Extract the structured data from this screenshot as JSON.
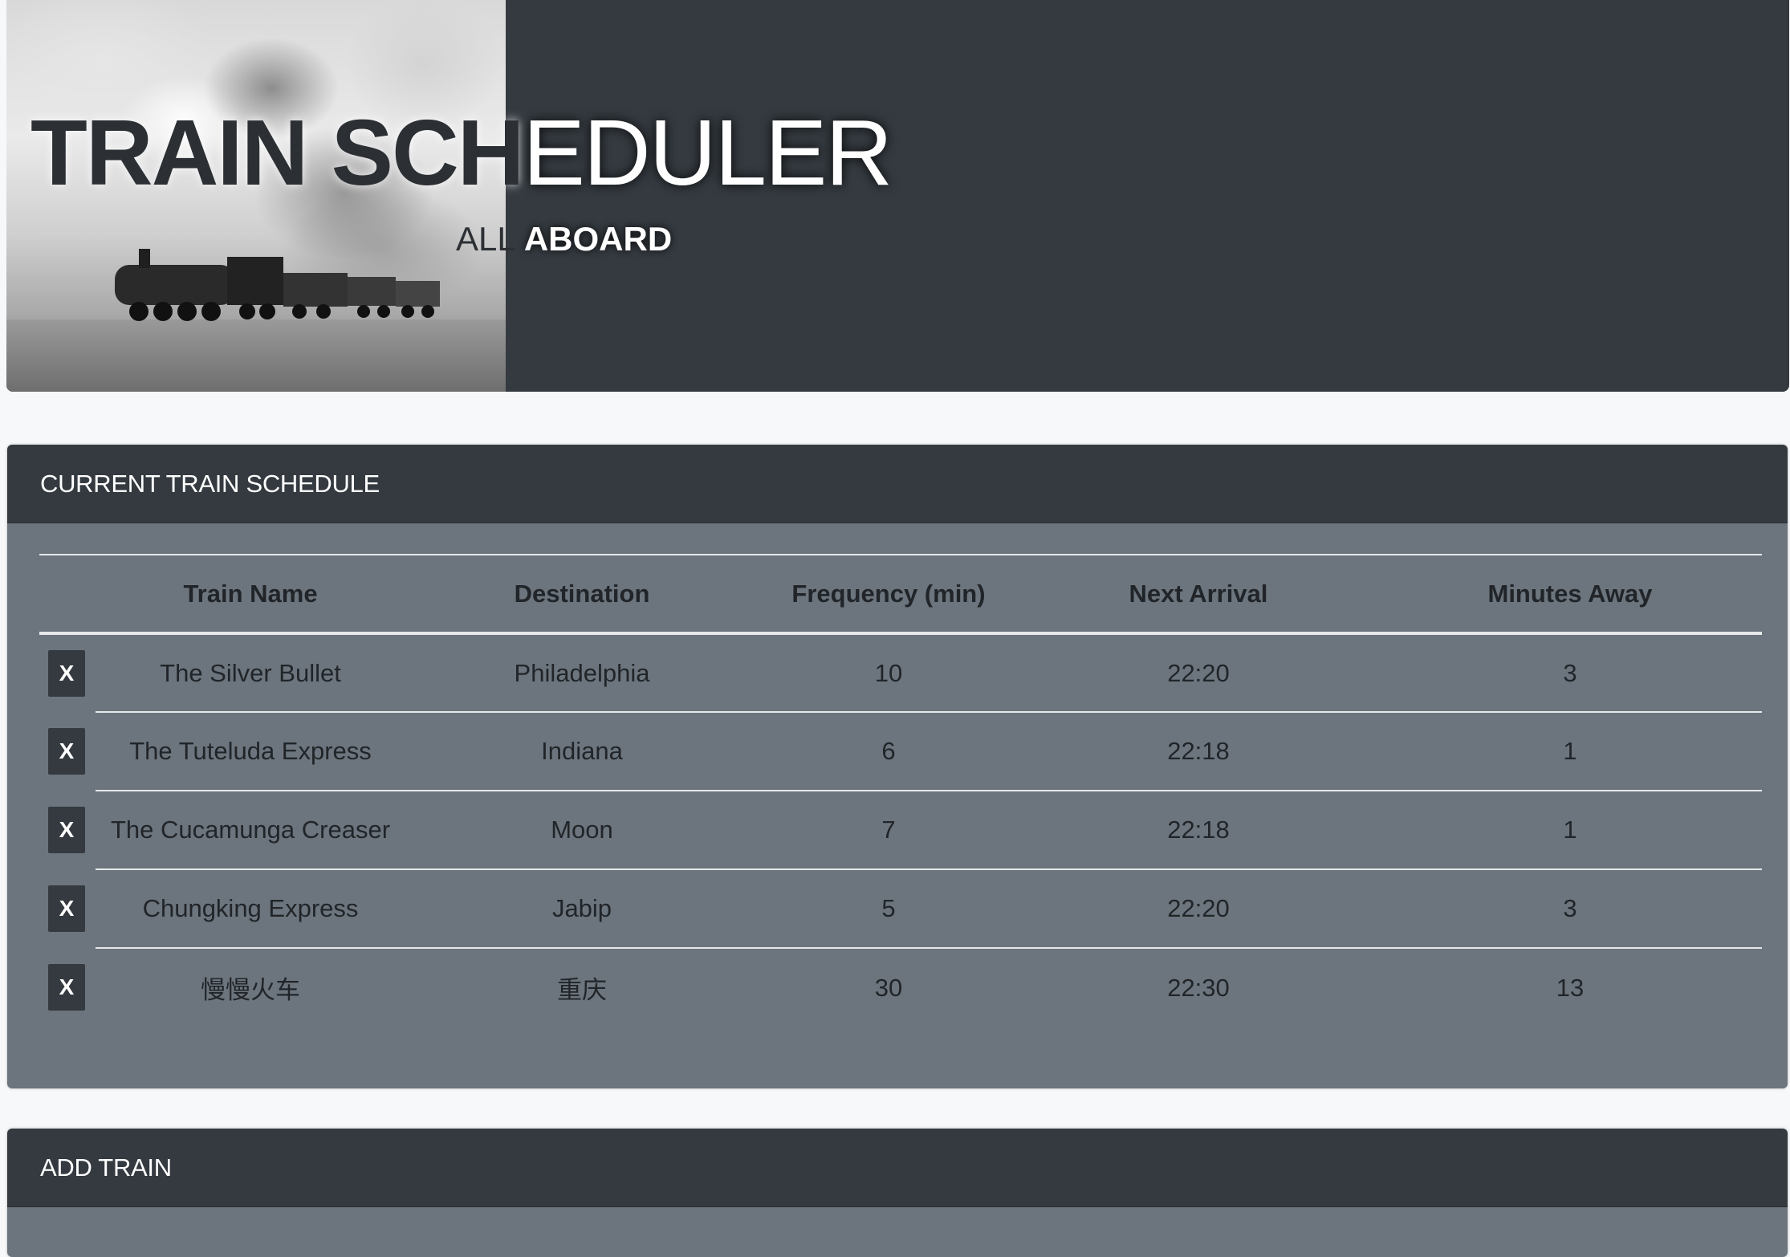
{
  "hero": {
    "title_dark": "TRAIN SCH",
    "title_light": "EDULER",
    "subtitle_dark": "ALL",
    "subtitle_light": "ABOARD"
  },
  "schedule": {
    "header": "CURRENT TRAIN SCHEDULE",
    "columns": [
      "",
      "Train Name",
      "Destination",
      "Frequency (min)",
      "Next Arrival",
      "Minutes Away"
    ],
    "delete_label": "X",
    "rows": [
      {
        "name": "The Silver Bullet",
        "destination": "Philadelphia",
        "frequency": "10",
        "next_arrival": "22:20",
        "minutes_away": "3"
      },
      {
        "name": "The Tuteluda Express",
        "destination": "Indiana",
        "frequency": "6",
        "next_arrival": "22:18",
        "minutes_away": "1"
      },
      {
        "name": "The Cucamunga Creaser",
        "destination": "Moon",
        "frequency": "7",
        "next_arrival": "22:18",
        "minutes_away": "1"
      },
      {
        "name": "Chungking Express",
        "destination": "Jabip",
        "frequency": "5",
        "next_arrival": "22:20",
        "minutes_away": "3"
      },
      {
        "name": "慢慢火车",
        "destination": "重庆",
        "frequency": "30",
        "next_arrival": "22:30",
        "minutes_away": "13"
      }
    ]
  },
  "add_train": {
    "header": "ADD TRAIN"
  },
  "colors": {
    "dark": "#343a40",
    "panel": "#6c757d",
    "page_bg": "#f7f8f9"
  },
  "icons": {
    "hero_image": "steam-locomotive-photo"
  }
}
